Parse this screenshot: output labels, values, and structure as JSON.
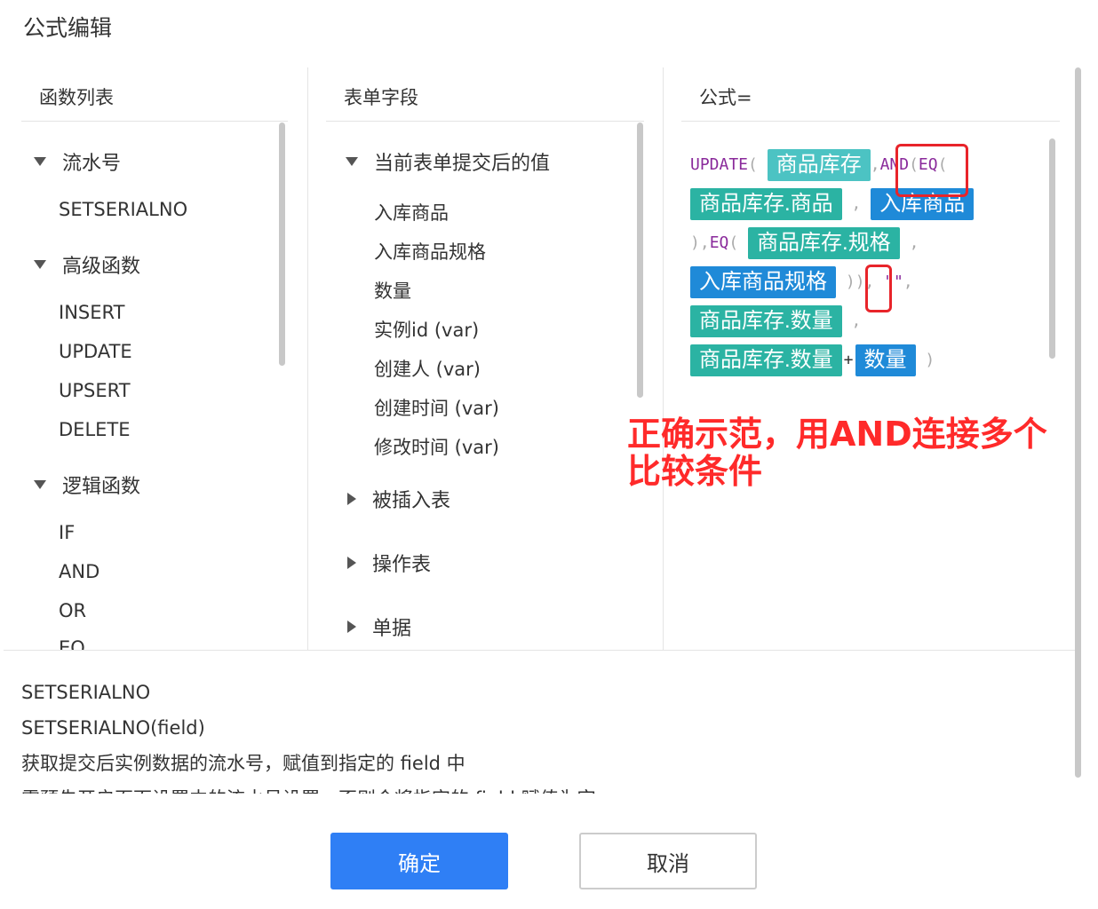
{
  "dialog": {
    "title": "公式编辑"
  },
  "functions": {
    "header": "函数列表",
    "groups": [
      {
        "label": "流水号",
        "items": [
          "SETSERIALNO"
        ]
      },
      {
        "label": "高级函数",
        "items": [
          "INSERT",
          "UPDATE",
          "UPSERT",
          "DELETE"
        ]
      },
      {
        "label": "逻辑函数",
        "items": [
          "IF",
          "AND",
          "OR",
          "EQ"
        ]
      }
    ]
  },
  "fields": {
    "header": "表单字段",
    "groups": [
      {
        "label": "当前表单提交后的值",
        "items": [
          "入库商品",
          "入库商品规格",
          "数量",
          "实例id (var)",
          "创建人 (var)",
          "创建时间 (var)",
          "修改时间 (var)"
        ]
      },
      {
        "label": "被插入表"
      },
      {
        "label": "操作表"
      },
      {
        "label": "单据"
      }
    ]
  },
  "formula": {
    "header": "公式=",
    "tokens": {
      "update": "UPDATE",
      "and": "AND",
      "eq": "EQ",
      "open": "(",
      "close": ")",
      "comma": ",",
      "plus": "+",
      "empty": "\"\"",
      "c1": "商品库存",
      "c2": "商品库存.商品",
      "c3": "入库商品",
      "c4": "商品库存.规格",
      "c5": "入库商品规格",
      "c6": "商品库存.数量",
      "c7": "商品库存.数量",
      "c8": "数量"
    }
  },
  "annotation": {
    "line1": "正确示范，用AND连接多个",
    "line2": "比较条件"
  },
  "description": {
    "lines": [
      "SETSERIALNO",
      "SETSERIALNO(field)",
      "获取提交后实例数据的流水号，赋值到指定的 field 中",
      "需预先开启页面设置中的流水号设置，否则会将指定的 field 赋值为空"
    ]
  },
  "buttons": {
    "ok": "确定",
    "cancel": "取消"
  }
}
